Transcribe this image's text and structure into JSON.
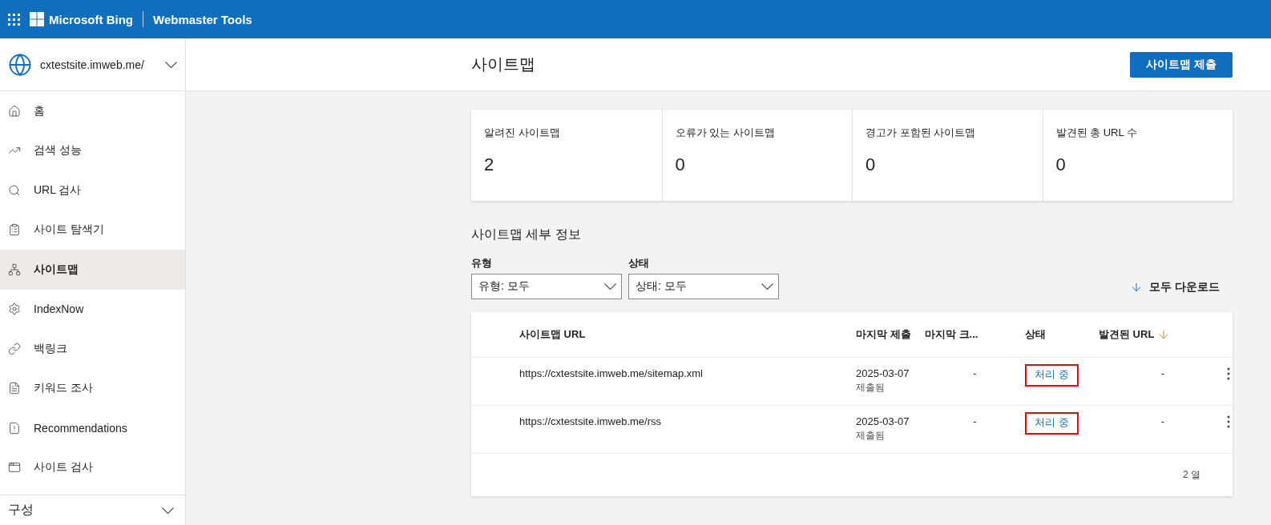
{
  "topbar": {
    "brand": "Microsoft Bing",
    "product": "Webmaster Tools"
  },
  "site_selector": {
    "value": "cxtestsite.imweb.me/"
  },
  "sidebar": {
    "items": [
      {
        "label": "홈",
        "kind": "home",
        "selected": false
      },
      {
        "label": "검색 성능",
        "kind": "trend",
        "selected": false
      },
      {
        "label": "URL 검사",
        "kind": "search",
        "selected": false
      },
      {
        "label": "사이트 탐색기",
        "kind": "list",
        "selected": false
      },
      {
        "label": "사이트맵",
        "kind": "network",
        "selected": true
      },
      {
        "label": "IndexNow",
        "kind": "gear",
        "selected": false
      },
      {
        "label": "백링크",
        "kind": "link",
        "selected": false
      },
      {
        "label": "키워드 조사",
        "kind": "doc",
        "selected": false
      },
      {
        "label": "Recommendations",
        "kind": "warn",
        "selected": false
      },
      {
        "label": "사이트 검사",
        "kind": "window",
        "selected": false
      }
    ],
    "section": {
      "label": "구성",
      "expanded": false
    }
  },
  "page": {
    "title": "사이트맵",
    "submit_button": "사이트맵 제출"
  },
  "stats": [
    {
      "label": "알려진 사이트맵",
      "value": "2"
    },
    {
      "label": "오류가 있는 사이트맵",
      "value": "0"
    },
    {
      "label": "경고가 포함된 사이트맵",
      "value": "0"
    },
    {
      "label": "발견된 총 URL 수",
      "value": "0"
    }
  ],
  "details": {
    "title": "사이트맵 세부 정보",
    "filters": [
      {
        "label": "유형",
        "value": "유형: 모두"
      },
      {
        "label": "상태",
        "value": "상태: 모두"
      }
    ],
    "download": "모두 다운로드"
  },
  "table": {
    "columns": [
      {
        "label": "사이트맵 URL",
        "sorted": false
      },
      {
        "label": "마지막 제출",
        "sorted": false
      },
      {
        "label": "마지막 크...",
        "sorted": false
      },
      {
        "label": "상태",
        "sorted": false
      },
      {
        "label": "발견된 URL",
        "sorted": true
      }
    ],
    "rows": [
      {
        "url": "https://cxtestsite.imweb.me/sitemap.xml",
        "date": "2025-03-07",
        "note": "제출됨",
        "last_crawl": "-",
        "status": "처리 중",
        "highlighted": true,
        "found": "-"
      },
      {
        "url": "https://cxtestsite.imweb.me/rss",
        "date": "2025-03-07",
        "note": "제출됨",
        "last_crawl": "-",
        "status": "처리 중",
        "highlighted": true,
        "found": "-"
      }
    ],
    "footer": "2 열"
  }
}
